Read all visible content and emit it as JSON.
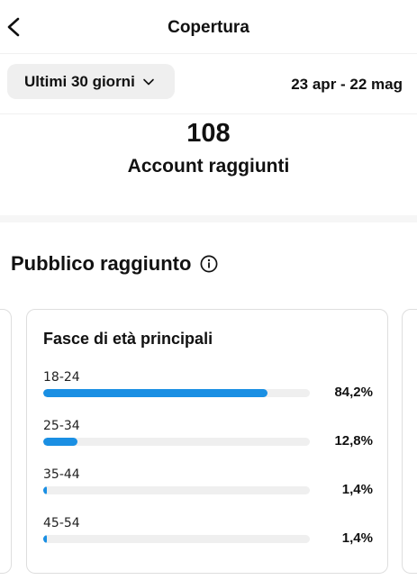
{
  "header": {
    "title": "Copertura"
  },
  "filter": {
    "period_label": "Ultimi 30 giorni",
    "date_range": "23 apr - 22 mag"
  },
  "metric": {
    "value": "108",
    "label": "Account raggiunti"
  },
  "audience": {
    "section_title": "Pubblico raggiunto",
    "card_title": "Fasce di età principali",
    "rows": [
      {
        "label": "18-24",
        "percent_text": "84,2%",
        "value": 84.2
      },
      {
        "label": "25-34",
        "percent_text": "12,8%",
        "value": 12.8
      },
      {
        "label": "35-44",
        "percent_text": "1,4%",
        "value": 1.4
      },
      {
        "label": "45-54",
        "percent_text": "1,4%",
        "value": 1.4
      }
    ]
  },
  "colors": {
    "accent": "#1a8fe3",
    "track": "#efefef",
    "pill": "#efefef"
  },
  "icons": {
    "back": "chevron-left-icon",
    "dropdown": "chevron-down-icon",
    "info": "info-icon"
  }
}
